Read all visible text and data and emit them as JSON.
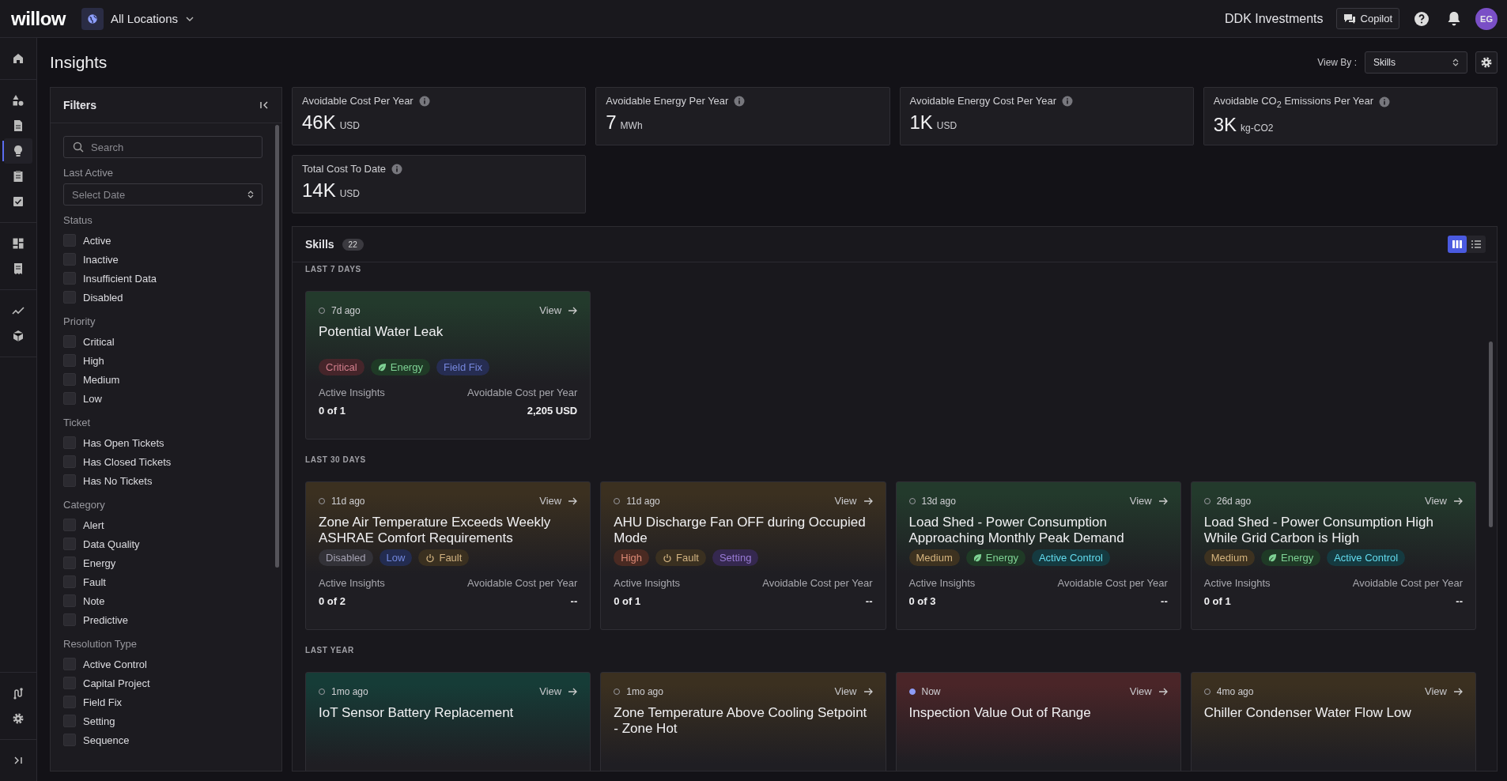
{
  "topbar": {
    "logo": "willow",
    "location": "All Locations",
    "company": "DDK Investments",
    "copilot": "Copilot",
    "avatar": "EG"
  },
  "rail": {
    "items": [
      {
        "kind": "home",
        "selected": false
      },
      {
        "kind": "shapes",
        "selected": false
      },
      {
        "kind": "doc",
        "selected": false
      },
      {
        "kind": "bulb",
        "selected": true
      },
      {
        "kind": "clipboard",
        "selected": false
      },
      {
        "kind": "check",
        "selected": false
      },
      {
        "kind": "dashboard",
        "selected": false
      },
      {
        "kind": "report",
        "selected": false
      },
      {
        "kind": "trend",
        "selected": false
      },
      {
        "kind": "cube",
        "selected": false
      }
    ]
  },
  "page": {
    "title": "Insights",
    "view_by_label": "View By :",
    "view_by": "Skills"
  },
  "filters": {
    "title": "Filters",
    "search_placeholder": "Search",
    "last_active_label": "Last Active",
    "date_placeholder": "Select Date",
    "sections": [
      {
        "title": "Status",
        "items": [
          {
            "label": "Active",
            "checked": false
          },
          {
            "label": "Inactive",
            "checked": false
          },
          {
            "label": "Insufficient Data",
            "checked": false
          },
          {
            "label": "Disabled",
            "checked": false
          }
        ]
      },
      {
        "title": "Priority",
        "items": [
          {
            "label": "Critical",
            "checked": false
          },
          {
            "label": "High",
            "checked": false
          },
          {
            "label": "Medium",
            "checked": false
          },
          {
            "label": "Low",
            "checked": false
          }
        ]
      },
      {
        "title": "Ticket",
        "items": [
          {
            "label": "Has Open Tickets",
            "checked": false
          },
          {
            "label": "Has Closed Tickets",
            "checked": false
          },
          {
            "label": "Has No Tickets",
            "checked": false
          }
        ]
      },
      {
        "title": "Category",
        "items": [
          {
            "label": "Alert",
            "checked": false
          },
          {
            "label": "Data Quality",
            "checked": false
          },
          {
            "label": "Energy",
            "checked": false
          },
          {
            "label": "Fault",
            "checked": false
          },
          {
            "label": "Note",
            "checked": false
          },
          {
            "label": "Predictive",
            "checked": false
          }
        ]
      },
      {
        "title": "Resolution Type",
        "items": [
          {
            "label": "Active Control",
            "checked": false
          },
          {
            "label": "Capital Project",
            "checked": false
          },
          {
            "label": "Field Fix",
            "checked": false
          },
          {
            "label": "Setting",
            "checked": false
          },
          {
            "label": "Sequence",
            "checked": false
          }
        ]
      }
    ]
  },
  "kpis": [
    {
      "label": "Avoidable Cost Per Year",
      "value": "46K",
      "unit": "USD"
    },
    {
      "label": "Avoidable Energy Per Year",
      "value": "7",
      "unit": "MWh"
    },
    {
      "label": "Avoidable Energy Cost Per Year",
      "value": "1K",
      "unit": "USD"
    },
    {
      "label": "Avoidable CO$_{2}$ Emissions Per Year",
      "value": "3K",
      "unit": "kg-CO2"
    },
    {
      "label": "Total Cost To Date",
      "value": "14K",
      "unit": "USD"
    }
  ],
  "skills": {
    "title": "Skills",
    "count": "22",
    "views": [
      {
        "kind": "grid",
        "selected": true
      },
      {
        "kind": "list",
        "selected": false
      }
    ],
    "sections": [
      {
        "heading": "LAST 7 DAYS",
        "cards": [
          {
            "color": "#233a2c",
            "live": false,
            "age": "7d ago",
            "view": "View",
            "title": "Potential Water Leak",
            "tags": [
              {
                "kind": "plain",
                "label": "Critical",
                "color": "#45252a"
              },
              {
                "kind": "energy",
                "label": "Energy",
                "color": "#1f3a26"
              },
              {
                "kind": "plain",
                "label": "Field Fix",
                "color": "#262d52"
              }
            ],
            "active_label": "Active Insights",
            "active_value": "0 of 1",
            "cost_label": "Avoidable Cost per Year",
            "cost_value": "2,205 USD"
          }
        ]
      },
      {
        "heading": "LAST 30 DAYS",
        "cards": [
          {
            "color": "#3b3020",
            "live": false,
            "age": "11d ago",
            "view": "View",
            "title": "Zone Air Temperature Exceeds Weekly ASHRAE Comfort Requirements",
            "tags": [
              {
                "kind": "plain",
                "label": "Disabled",
                "color": "#333238"
              },
              {
                "kind": "plain",
                "label": "Low",
                "color": "#232c50"
              },
              {
                "kind": "fault",
                "label": "Fault",
                "color": "#3a3020"
              }
            ],
            "active_label": "Active Insights",
            "active_value": "0 of 2",
            "cost_label": "Avoidable Cost per Year",
            "cost_value": "--"
          },
          {
            "color": "#3b3020",
            "live": false,
            "age": "11d ago",
            "view": "View",
            "title": "AHU Discharge Fan OFF during Occupied Mode",
            "tags": [
              {
                "kind": "plain",
                "label": "High",
                "color": "#4a2a22"
              },
              {
                "kind": "fault",
                "label": "Fault",
                "color": "#3a3020"
              },
              {
                "kind": "plain",
                "label": "Setting",
                "color": "#35284f"
              }
            ],
            "active_label": "Active Insights",
            "active_value": "0 of 1",
            "cost_label": "Avoidable Cost per Year",
            "cost_value": "--"
          },
          {
            "color": "#233a2c",
            "live": false,
            "age": "13d ago",
            "view": "View",
            "title": "Load Shed - Power Consumption Approaching Monthly Peak Demand",
            "tags": [
              {
                "kind": "plain",
                "label": "Medium",
                "color": "#3d3220"
              },
              {
                "kind": "energy",
                "label": "Energy",
                "color": "#1f3a26"
              },
              {
                "kind": "plain",
                "label": "Active Control",
                "color": "#153a40"
              }
            ],
            "active_label": "Active Insights",
            "active_value": "0 of 3",
            "cost_label": "Avoidable Cost per Year",
            "cost_value": "--"
          },
          {
            "color": "#233a2c",
            "live": false,
            "age": "26d ago",
            "view": "View",
            "title": "Load Shed - Power Consumption High While Grid Carbon is High",
            "tags": [
              {
                "kind": "plain",
                "label": "Medium",
                "color": "#3d3220"
              },
              {
                "kind": "energy",
                "label": "Energy",
                "color": "#1f3a26"
              },
              {
                "kind": "plain",
                "label": "Active Control",
                "color": "#153a40"
              }
            ],
            "active_label": "Active Insights",
            "active_value": "0 of 1",
            "cost_label": "Avoidable Cost per Year",
            "cost_value": "--"
          }
        ]
      },
      {
        "heading": "LAST YEAR",
        "cards": [
          {
            "color": "#163c37",
            "live": false,
            "age": "1mo ago",
            "view": "View",
            "title": "IoT Sensor Battery Replacement"
          },
          {
            "color": "#3b3020",
            "live": false,
            "age": "1mo ago",
            "view": "View",
            "title": "Zone Temperature Above Cooling Setpoint - Zone Hot"
          },
          {
            "color": "#4a2528",
            "live": true,
            "age": "Now",
            "view": "View",
            "title": "Inspection Value Out of Range"
          },
          {
            "color": "#3b3020",
            "live": false,
            "age": "4mo ago",
            "view": "View",
            "title": "Chiller Condenser Water Flow Low"
          }
        ]
      }
    ]
  }
}
